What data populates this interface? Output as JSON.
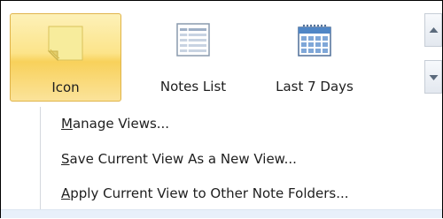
{
  "gallery": {
    "items": [
      {
        "label": "Icon",
        "icon": "sticky-note-icon",
        "selected": true
      },
      {
        "label": "Notes List",
        "icon": "list-view-icon",
        "selected": false
      },
      {
        "label": "Last 7 Days",
        "icon": "calendar-icon",
        "selected": false
      }
    ]
  },
  "menu": {
    "items": [
      {
        "accel": "M",
        "rest": "anage Views..."
      },
      {
        "accel": "S",
        "rest": "ave Current View As a New View..."
      },
      {
        "accel": "A",
        "rest": "pply Current View to Other Note Folders..."
      }
    ]
  },
  "colors": {
    "selected_highlight": "#fce48a",
    "selected_border": "#e0b44a",
    "calendar_blue": "#4f86c6"
  }
}
